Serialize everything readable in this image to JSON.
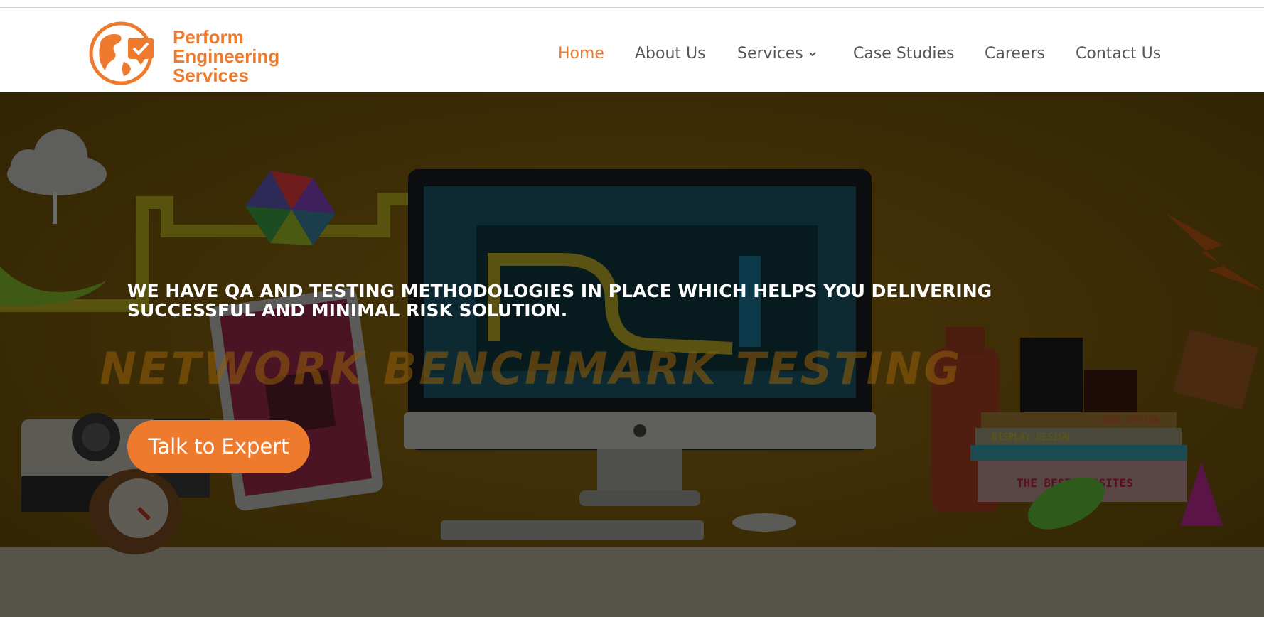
{
  "brand": {
    "name_line1": "Perform",
    "name_line2": "Engineering",
    "name_line3": "Services",
    "accent_color": "#ee7a2e",
    "logo_icon": "globe-check-icon"
  },
  "nav": {
    "home": "Home",
    "about": "About Us",
    "services": "Services",
    "case_studies": "Case Studies",
    "careers": "Careers",
    "contact": "Contact Us",
    "services_icon": "chevron-down-icon"
  },
  "hero": {
    "headline": "WE HAVE QA AND TESTING METHODOLOGIES IN PLACE WHICH HELPS YOU DELIVERING SUCCESSFUL AND MINIMAL RISK SOLUTION.",
    "watermark": "NETWORK BENCHMARK TESTING",
    "cta_label": "Talk to Expert",
    "book_labels": [
      "LOGO DESIGN",
      "DISPLAY DESIGN",
      "THE BEST WEBSITES"
    ]
  }
}
